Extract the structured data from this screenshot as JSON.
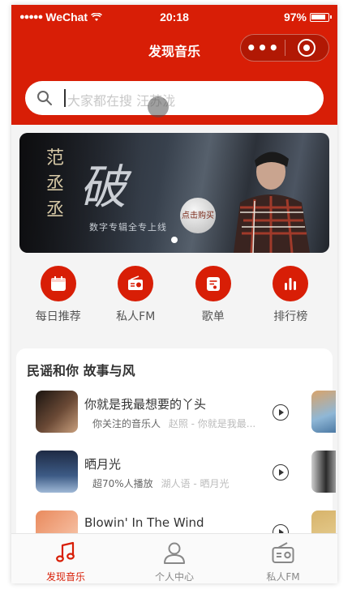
{
  "status_bar": {
    "carrier": "WeChat",
    "time": "20:18",
    "battery": "97%"
  },
  "nav": {
    "title": "发现音乐",
    "more_icon": "more-dots-icon",
    "close_icon": "target-circle-icon"
  },
  "search": {
    "placeholder": "大家都在搜 汪苏泷"
  },
  "banner": {
    "left_text": "范丞丞",
    "title": "破",
    "subtitle": "数字专辑全专上线",
    "seal": "点击购买",
    "page_index": 1,
    "page_count": 1
  },
  "categories": [
    {
      "label": "每日推荐",
      "icon": "calendar-icon"
    },
    {
      "label": "私人FM",
      "icon": "radio-icon"
    },
    {
      "label": "歌单",
      "icon": "playlist-icon"
    },
    {
      "label": "排行榜",
      "icon": "bar-chart-icon"
    }
  ],
  "recommend": {
    "title": "民谣和你 故事与风",
    "songs": [
      {
        "name": "你就是我最想要的丫头",
        "tag": "你关注的音乐人",
        "artist": "赵照 - 你就是我最..."
      },
      {
        "name": "晒月光",
        "tag": "超70%人播放",
        "artist": "湖人语 - 晒月光"
      },
      {
        "name": "Blowin' In The Wind",
        "tag": "",
        "artist": ""
      }
    ]
  },
  "tabs": [
    {
      "label": "发现音乐",
      "icon": "music-note-icon",
      "active": true
    },
    {
      "label": "个人中心",
      "icon": "user-icon",
      "active": false
    },
    {
      "label": "私人FM",
      "icon": "radio-icon",
      "active": false
    }
  ],
  "colors": {
    "primary": "#d81e06",
    "tab_inactive": "#888888"
  }
}
